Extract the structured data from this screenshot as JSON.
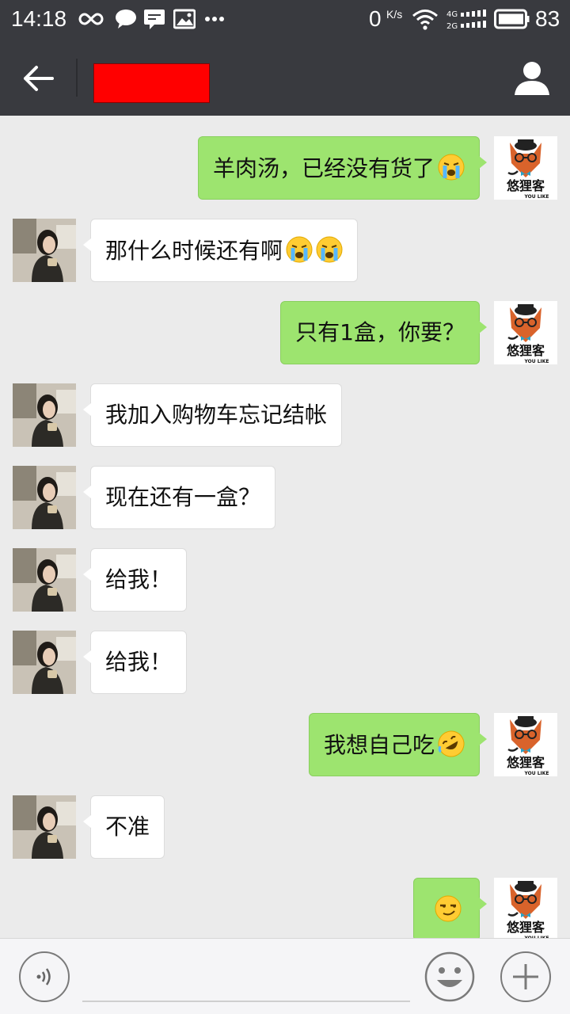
{
  "status_bar": {
    "time": "14:18",
    "net_speed": "0",
    "net_unit": "K/s",
    "battery_percent": "83",
    "icons": [
      "infinity-icon",
      "message-bubble-icon",
      "chat-icon",
      "image-icon",
      "more-dots-icon",
      "wifi-icon",
      "signal-icon",
      "battery-icon"
    ]
  },
  "header": {
    "title": "",
    "back_icon": "arrow-left-icon",
    "profile_icon": "person-icon"
  },
  "messages": [
    {
      "side": "out",
      "text": "羊肉汤，已经没有货了",
      "emojis": [
        "loudly-crying"
      ]
    },
    {
      "side": "in",
      "text": "那什么时候还有啊",
      "emojis": [
        "loudly-crying",
        "loudly-crying"
      ]
    },
    {
      "side": "out",
      "text": "只有1盒，你要？",
      "emojis": []
    },
    {
      "side": "in",
      "text": "我加入购物车忘记结帐",
      "emojis": []
    },
    {
      "side": "in",
      "text": "现在还有一盒？",
      "emojis": []
    },
    {
      "side": "in",
      "text": "给我！",
      "emojis": []
    },
    {
      "side": "in",
      "text": "给我！",
      "emojis": []
    },
    {
      "side": "out",
      "text": "我想自己吃",
      "emojis": [
        "rolling-laughing"
      ]
    },
    {
      "side": "in",
      "text": "不准",
      "emojis": []
    },
    {
      "side": "out",
      "text": "",
      "emojis": [
        "smirk"
      ]
    }
  ],
  "my_avatar": {
    "logo_text": "悠狸客",
    "logo_subtext": "YOU LIKE"
  },
  "input_bar": {
    "placeholder": "",
    "voice_icon": "voice-icon",
    "emoji_icon": "smiley-icon",
    "more_icon": "plus-icon"
  },
  "colors": {
    "header": "#393a3f",
    "outgoing_bubble": "#9de46f",
    "incoming_bubble": "#ffffff",
    "background": "#ebebeb"
  }
}
